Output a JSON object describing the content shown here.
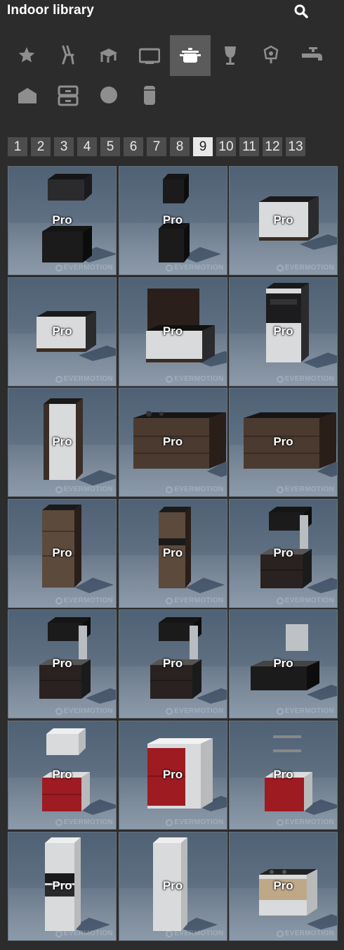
{
  "header": {
    "title": "Indoor library",
    "search_icon": "search-icon"
  },
  "categories": [
    {
      "icon": "star-icon",
      "active": false
    },
    {
      "icon": "chair-icon",
      "active": false
    },
    {
      "icon": "table-icon",
      "active": false
    },
    {
      "icon": "tv-icon",
      "active": false
    },
    {
      "icon": "cooking-pot-icon",
      "active": true
    },
    {
      "icon": "wine-glass-icon",
      "active": false
    },
    {
      "icon": "lamp-icon",
      "active": false
    },
    {
      "icon": "faucet-icon",
      "active": false
    },
    {
      "icon": "box-icon",
      "active": false
    },
    {
      "icon": "drawers-icon",
      "active": false
    },
    {
      "icon": "circle-icon",
      "active": false
    },
    {
      "icon": "cylinder-icon",
      "active": false
    }
  ],
  "pagination": {
    "pages": [
      "1",
      "2",
      "3",
      "4",
      "5",
      "6",
      "7",
      "8",
      "9",
      "10",
      "11",
      "12",
      "13"
    ],
    "current": "9"
  },
  "items": [
    {
      "label": "Pro",
      "model": "wall-shelf-and-base-dark"
    },
    {
      "label": "Pro",
      "model": "tall-dark-cabinet-pair"
    },
    {
      "label": "Pro",
      "model": "white-base-sink"
    },
    {
      "label": "Pro",
      "model": "white-base-low"
    },
    {
      "label": "Pro",
      "model": "hob-with-backsplash"
    },
    {
      "label": "Pro",
      "model": "oven-tall-white"
    },
    {
      "label": "Pro",
      "model": "tall-white-fridge"
    },
    {
      "label": "Pro",
      "model": "wood-island-hob"
    },
    {
      "label": "Pro",
      "model": "wood-island"
    },
    {
      "label": "Pro",
      "model": "tall-wood-cabinet"
    },
    {
      "label": "Pro",
      "model": "tall-wood-narrow"
    },
    {
      "label": "Pro",
      "model": "dark-kitchen-unit"
    },
    {
      "label": "Pro",
      "model": "dark-kitchen-unit"
    },
    {
      "label": "Pro",
      "model": "dark-kitchen-unit"
    },
    {
      "label": "Pro",
      "model": "dark-corner-unit"
    },
    {
      "label": "Pro",
      "model": "red-base-wall"
    },
    {
      "label": "Pro",
      "model": "red-base-wide"
    },
    {
      "label": "Pro",
      "model": "red-base-shelves"
    },
    {
      "label": "Pro",
      "model": "tall-white-oven"
    },
    {
      "label": "Pro",
      "model": "tall-white-column"
    },
    {
      "label": "Pro",
      "model": "wood-front-base-hob"
    }
  ],
  "watermark": "EVERMOTION",
  "colors": {
    "background": "#2c2c2c",
    "active_category": "#5b5b5b",
    "page_button": "#4d4d4d",
    "active_page": "#e8e8e8"
  }
}
